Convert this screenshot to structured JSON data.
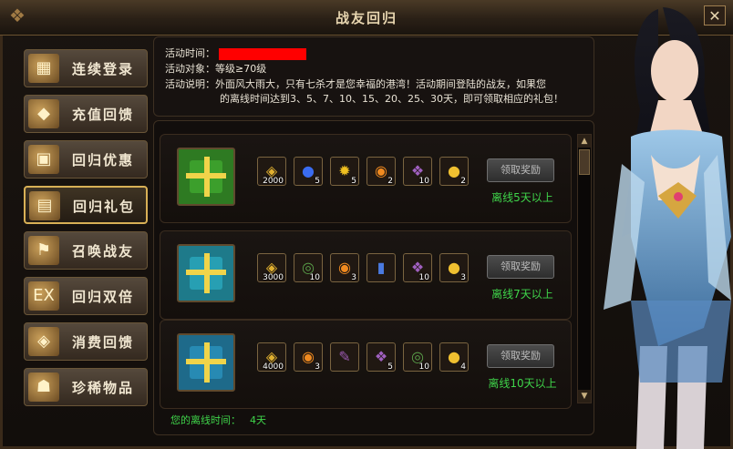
{
  "window": {
    "title": "战友回归",
    "close_glyph": "✕"
  },
  "sidebar": {
    "items": [
      {
        "label": "连续登录",
        "icon": "calendar-icon",
        "glyph": "▦"
      },
      {
        "label": "充值回馈",
        "icon": "gold-bag-icon",
        "glyph": "◆"
      },
      {
        "label": "回归优惠",
        "icon": "gift-pile-icon",
        "glyph": "▣"
      },
      {
        "label": "回归礼包",
        "icon": "treasure-chest-icon",
        "glyph": "▤",
        "active": true
      },
      {
        "label": "召唤战友",
        "icon": "banner-icon",
        "glyph": "⚑"
      },
      {
        "label": "回归双倍",
        "icon": "exp-scroll-icon",
        "glyph": "EX"
      },
      {
        "label": "消费回馈",
        "icon": "gold-ingot-icon",
        "glyph": "◈"
      },
      {
        "label": "珍稀物品",
        "icon": "demon-mask-icon",
        "glyph": "☗"
      }
    ]
  },
  "info": {
    "time_label": "活动时间：",
    "target_label": "活动对象：",
    "target_value": "等级≥70级",
    "desc_label": "活动说明：",
    "desc_line1": "外面风大雨大，只有七杀才是您幸福的港湾！活动期间登陆的战友，如果您",
    "desc_line2": "的离线时间达到3、5、7、10、15、20、25、30天，即可领取相应的礼包！"
  },
  "rewards": [
    {
      "gift_color": "#2e7a22",
      "items": [
        {
          "icon": "gold-ingot-icon",
          "glyph": "◈",
          "qty": "2000",
          "color": "#e0b030"
        },
        {
          "icon": "blue-orb-icon",
          "glyph": "●",
          "qty": "5",
          "color": "#3a6cf0"
        },
        {
          "icon": "yellow-gem-icon",
          "glyph": "✹",
          "qty": "5",
          "color": "#f0c020"
        },
        {
          "icon": "flame-coin-icon",
          "glyph": "◉",
          "qty": "2",
          "color": "#f08a20"
        },
        {
          "icon": "purple-scroll-icon",
          "glyph": "❖",
          "qty": "10",
          "color": "#a060c0"
        },
        {
          "icon": "gold-coin-icon",
          "glyph": "●",
          "qty": "2",
          "color": "#f0c030"
        }
      ],
      "button": "领取奖励",
      "requirement": "离线5天以上"
    },
    {
      "gift_color": "#1e7a8a",
      "items": [
        {
          "icon": "gold-ingot-icon",
          "glyph": "◈",
          "qty": "3000",
          "color": "#e0b030"
        },
        {
          "icon": "jade-ring-icon",
          "glyph": "◎",
          "qty": "10",
          "color": "#5aa04a"
        },
        {
          "icon": "flame-coin-icon",
          "glyph": "◉",
          "qty": "3",
          "color": "#f08a20"
        },
        {
          "icon": "blue-card-icon",
          "glyph": "▮",
          "qty": "",
          "color": "#4a7ae0"
        },
        {
          "icon": "purple-scroll-icon",
          "glyph": "❖",
          "qty": "10",
          "color": "#a060c0"
        },
        {
          "icon": "gold-coin-icon",
          "glyph": "●",
          "qty": "3",
          "color": "#f0c030"
        }
      ],
      "button": "领取奖励",
      "requirement": "离线7天以上"
    },
    {
      "gift_color": "#1e6a8a",
      "items": [
        {
          "icon": "gold-ingot-icon",
          "glyph": "◈",
          "qty": "4000",
          "color": "#e0b030"
        },
        {
          "icon": "flame-coin-icon",
          "glyph": "◉",
          "qty": "3",
          "color": "#f08a20"
        },
        {
          "icon": "purple-bone-icon",
          "glyph": "✎",
          "qty": "",
          "color": "#9a5ab0"
        },
        {
          "icon": "purple-scroll-icon",
          "glyph": "❖",
          "qty": "5",
          "color": "#a060c0"
        },
        {
          "icon": "jade-ring-icon",
          "glyph": "◎",
          "qty": "10",
          "color": "#5aa04a"
        },
        {
          "icon": "gold-coin-icon",
          "glyph": "●",
          "qty": "4",
          "color": "#f0c030"
        }
      ],
      "button": "领取奖励",
      "requirement": "离线10天以上"
    }
  ],
  "footer": {
    "label": "您的离线时间：",
    "value": "4天"
  }
}
